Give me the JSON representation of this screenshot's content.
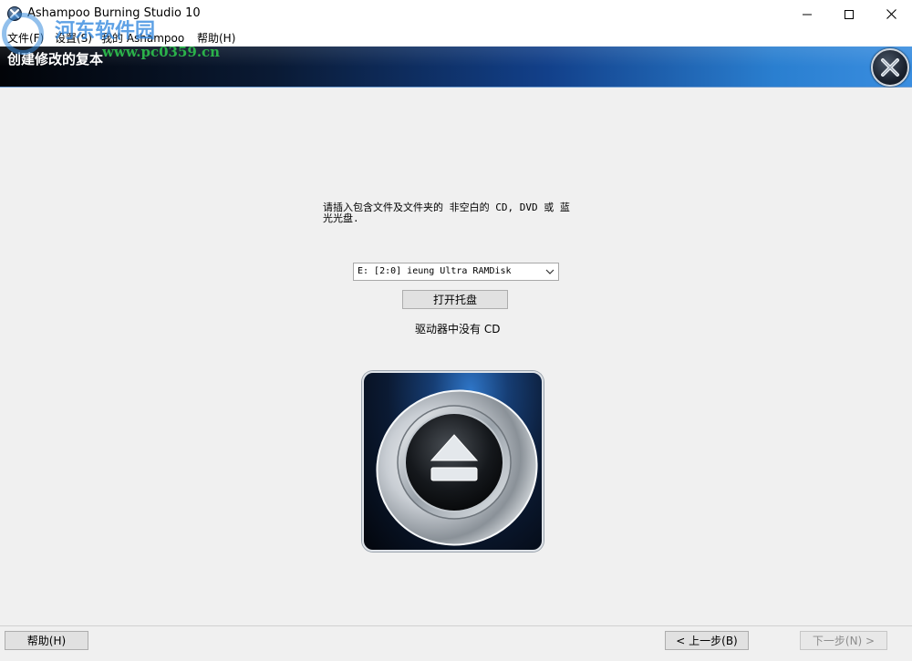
{
  "window": {
    "title": "Ashampoo Burning Studio 10",
    "icon": "ashampoo-x-icon"
  },
  "menu": [
    {
      "label": "文件(F)"
    },
    {
      "label": "设置(S)"
    },
    {
      "label": "我的 Ashampoo"
    },
    {
      "label": "帮助(H)"
    }
  ],
  "watermark": {
    "cn": "河东软件园",
    "url": "www.pc0359.cn"
  },
  "header": {
    "title": "创建修改的复本",
    "close_icon": "ashampoo-x-icon"
  },
  "main": {
    "instruction": "请插入包含文件及文件夹的 非空白的 CD, DVD 或 蓝光光盘.",
    "drive_value": "E: [2:0] ieung   Ultra RAMDisk",
    "open_tray_label": "打开托盘",
    "status": "驱动器中没有 CD",
    "art_icon": "eject-disc-icon"
  },
  "footer": {
    "help_label": "帮助(H)",
    "back_label": "< 上一步(B)",
    "next_label": "下一步(N) >",
    "next_enabled": false
  },
  "colors": {
    "header_dark": "#020408",
    "header_light": "#3a8ee0",
    "window_bg": "#f0f0f0"
  }
}
